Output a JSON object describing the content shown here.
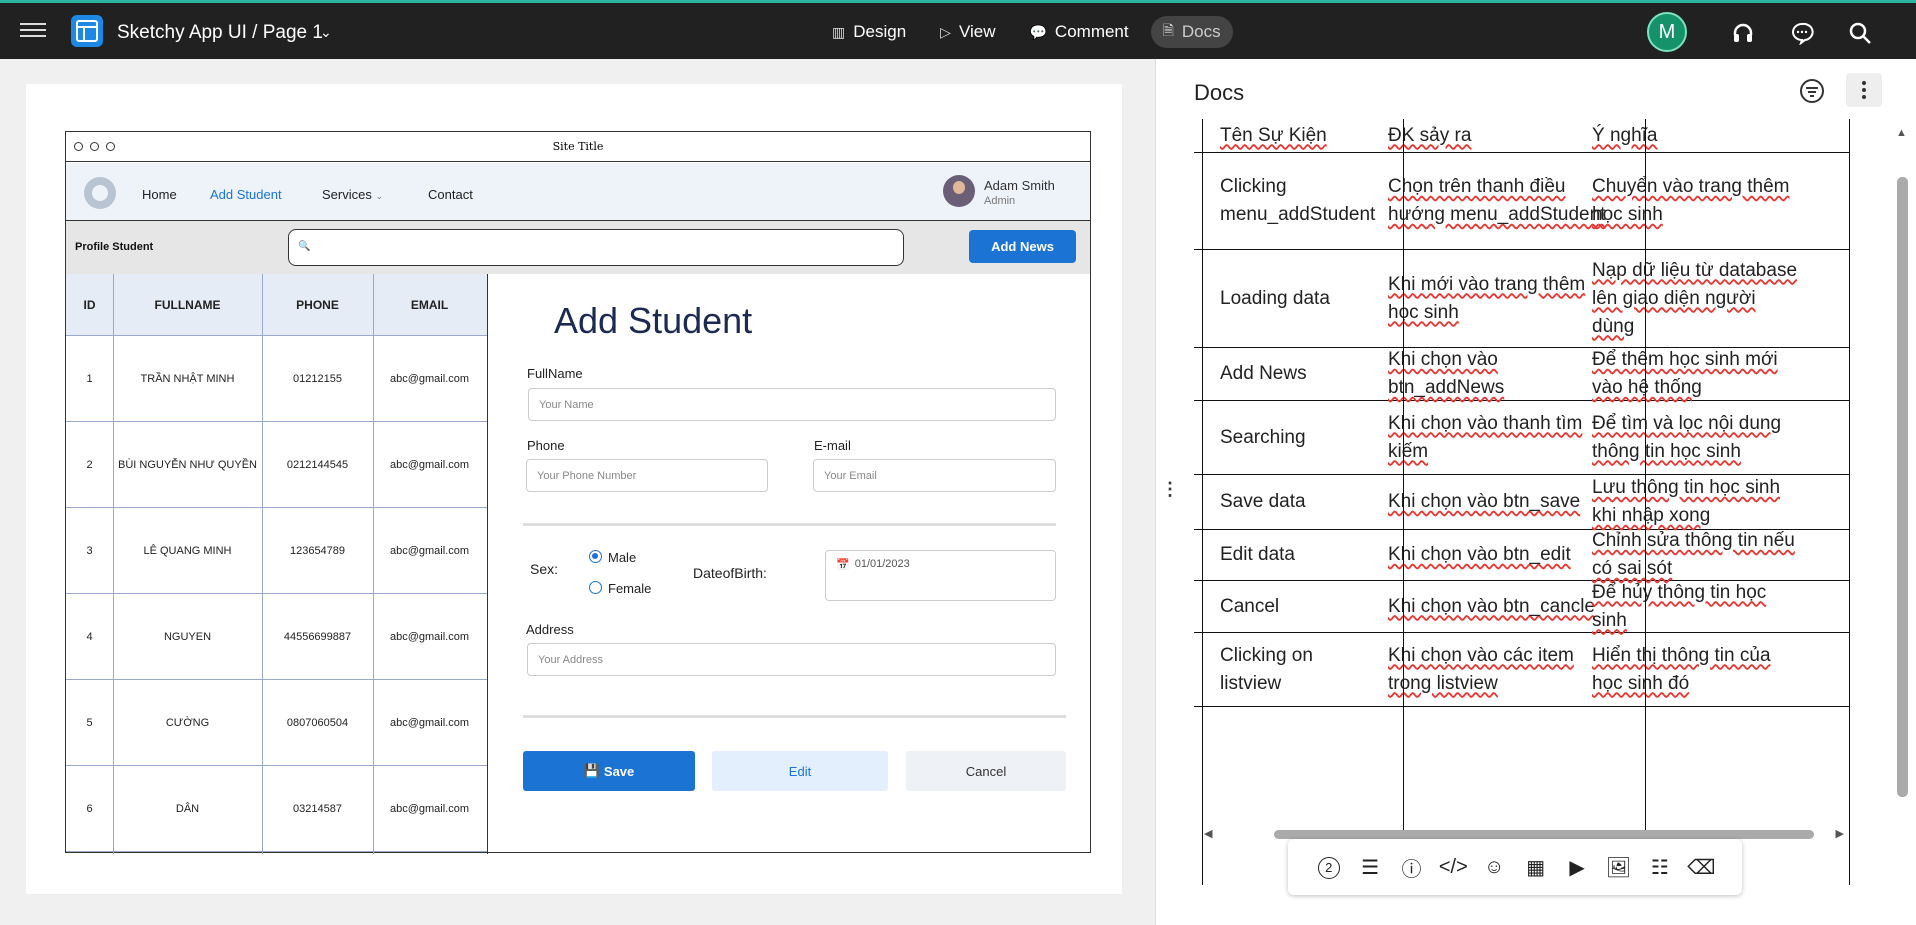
{
  "app": {
    "title": "Sketchy App UI / Page 1",
    "avatar_letter": "M",
    "accent": "#2bb4a0"
  },
  "modes": [
    {
      "label": "Design",
      "icon": "design-icon"
    },
    {
      "label": "View",
      "icon": "play-icon"
    },
    {
      "label": "Comment",
      "icon": "comment-icon"
    },
    {
      "label": "Docs",
      "icon": "document-icon",
      "active": true
    }
  ],
  "mockup": {
    "site_title": "Site Title",
    "nav": [
      "Home",
      "Add Student",
      "Services",
      "Contact"
    ],
    "user": {
      "name": "Adam Smith",
      "role": "Admin"
    },
    "profile_label": "Profile Student",
    "add_news": "Add News",
    "table": {
      "headers": [
        "ID",
        "FULLNAME",
        "PHONE",
        "EMAIL"
      ],
      "rows": [
        [
          "1",
          "TRẦN NHẬT MINH",
          "01212155",
          "abc@gmail.com"
        ],
        [
          "2",
          "BÙI NGUYỄN NHƯ QUYỀN",
          "0212144545",
          "abc@gmail.com"
        ],
        [
          "3",
          "LÊ QUANG MINH",
          "123654789",
          "abc@gmail.com"
        ],
        [
          "4",
          "NGUYEN",
          "44556699887",
          "abc@gmail.com"
        ],
        [
          "5",
          "CƯỜNG",
          "0807060504",
          "abc@gmail.com"
        ],
        [
          "6",
          "DÂN",
          "03214587",
          "abc@gmail.com"
        ]
      ]
    },
    "form": {
      "title": "Add Student",
      "fullname_label": "FullName",
      "fullname_ph": "Your Name",
      "phone_label": "Phone",
      "phone_ph": "Your Phone Number",
      "email_label": "E-mail",
      "email_ph": "Your Email",
      "sex_label": "Sex:",
      "male": "Male",
      "female": "Female",
      "dob_label": "DateofBirth:",
      "dob_value": "01/01/2023",
      "address_label": "Address",
      "address_ph": "Your Address",
      "save": "Save",
      "edit": "Edit",
      "cancel": "Cancel"
    }
  },
  "docs": {
    "title": "Docs",
    "rows": [
      [
        "Tên Sự Kiện",
        "ĐK sảy ra",
        "Ý nghĩa"
      ],
      [
        "Clicking menu_addStudent",
        "Chọn trên thanh điều hướng menu_addStudent",
        "Chuyển vào trang thêm học sinh"
      ],
      [
        "Loading data",
        "Khi mới vào trang thêm học sinh",
        "Nạp dữ liệu từ database lên giao diện người dùng"
      ],
      [
        "Add News",
        "Khi chọn vào btn_addNews",
        "Để thêm học sinh mới vào hệ thống"
      ],
      [
        "Searching",
        "Khi chọn vào thanh tìm kiếm",
        "Để tìm và lọc nội dung thông tin học sinh"
      ],
      [
        "Save data",
        "Khi chọn vào btn_save",
        "Lưu thông tin học sinh khi nhập xong"
      ],
      [
        "Edit data",
        "Khi chọn vào btn_edit",
        "Chỉnh sửa thông tin nếu có sai sót"
      ],
      [
        "Cancel",
        "Khi chọn vào btn_cancle",
        "Để hủy thông tin học sinh"
      ],
      [
        "Clicking on listview",
        "Khi chọn vào các item trong listview",
        "Hiển thị thông tin của học sinh đó"
      ]
    ],
    "tools": [
      "count-icon",
      "layout-icon",
      "info-icon",
      "code-icon",
      "emoji-icon",
      "table-icon",
      "video-icon",
      "image-icon",
      "divider-icon",
      "eraser-icon"
    ],
    "tool_count": "2"
  }
}
